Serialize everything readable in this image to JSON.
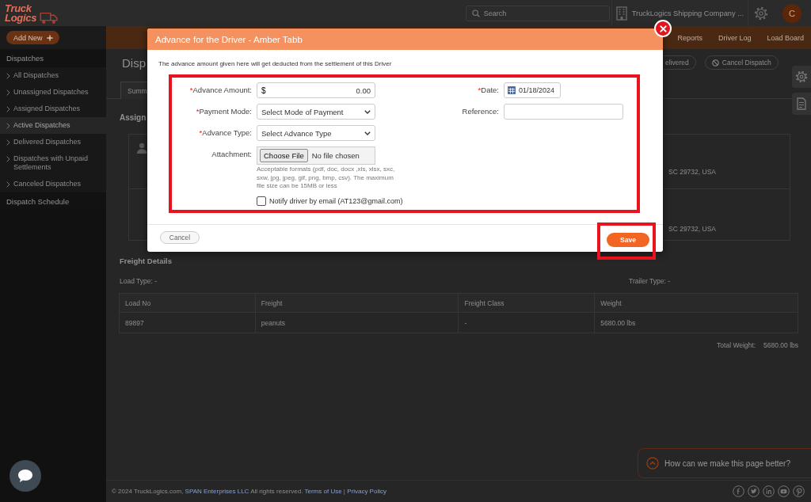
{
  "header": {
    "logo": {
      "line_1": "Truck",
      "line_2": "Logics"
    },
    "search": {
      "placeholder": "Search"
    },
    "company": "TruckLogics Shipping Company ...",
    "avatar_initial": "C"
  },
  "nav": {
    "add_button": "Add New",
    "links": [
      "Reports",
      "Driver Log",
      "Load Board"
    ]
  },
  "sidebar": {
    "sections": [
      {
        "title": "Dispatches",
        "items": [
          {
            "label": "All Dispatches",
            "selected": false
          },
          {
            "label": "Unassigned Dispatches",
            "selected": false
          },
          {
            "label": "Assigned Dispatches",
            "selected": false
          },
          {
            "label": "Active Dispatches",
            "selected": true
          },
          {
            "label": "Delivered Dispatches",
            "selected": false
          },
          {
            "label": "Dispatches with Unpaid Settlements",
            "selected": false
          },
          {
            "label": "Canceled Dispatches",
            "selected": false
          }
        ]
      },
      {
        "title": "Dispatch Schedule"
      }
    ]
  },
  "page": {
    "title": "Disp",
    "actions": [
      {
        "label": "elivered",
        "kind": "plain"
      },
      {
        "label": "Cancel Dispatch",
        "kind": "cancel"
      }
    ],
    "tabs": [
      {
        "label": "Summ",
        "selected": true
      }
    ],
    "assign": {
      "title": "Assign",
      "cards": [
        {
          "kind": "driver",
          "address": "SC 29732, USA"
        },
        {
          "kind": "location",
          "address": "SC 29732, USA"
        }
      ]
    },
    "freight": {
      "title": "Freight Details",
      "load_type": "Load Type: -",
      "trailer_type": "Trailer Type: -",
      "table": {
        "columns": [
          "Load No",
          "Freight",
          "Freight Class",
          "Weight"
        ],
        "rows": [
          [
            "89897",
            "peanuts",
            "-",
            "5680.00 lbs"
          ]
        ]
      },
      "total_label": "Total Weight:",
      "total_value": "5680.00 lbs"
    }
  },
  "footer": {
    "copyright": "© 2024 TruckLogics.com,",
    "company_link": "SPAN Enterprises LLC",
    "rights": "All rights reserved.",
    "links": [
      "Terms of Use",
      "Privacy Policy"
    ],
    "separator": "|"
  },
  "feedback": {
    "label": "How can we make this page better?"
  },
  "modal": {
    "title": "Advance for the Driver - Amber Tabb",
    "intro": "The advance amount given here will get deducted from the settlement of this Driver",
    "required_mark": "*",
    "form_highlighted": true,
    "left_fields": [
      {
        "kind": "amount",
        "label": "Advance Amount:",
        "required": true,
        "prefix": "$",
        "value": "0.00"
      },
      {
        "kind": "select",
        "label": "Payment Mode:",
        "required": true,
        "value": "Select Mode of Payment"
      },
      {
        "kind": "select",
        "label": "Advance Type:",
        "required": true,
        "value": "Select Advance Type"
      },
      {
        "kind": "file",
        "label": "Attachment:",
        "required": false,
        "button": "Choose File",
        "value": "No file chosen",
        "hint": "Acceptable formats (pdf, doc, docx ,xls, xlsx, sxc, sxw, jpg, jpeg, gif, png, bmp, csv). The maximum file size can be 15MB or less"
      }
    ],
    "right_fields": [
      {
        "kind": "date",
        "label": "Date:",
        "required": true,
        "value": "01/18/2024"
      },
      {
        "kind": "text",
        "label": "Reference:",
        "required": false
      }
    ],
    "notify": {
      "label": "Notify driver by email (AT123@gmail.com)",
      "checked": false
    },
    "buttons": [
      {
        "label": "Cancel",
        "kind": "secondary",
        "highlighted": false
      },
      {
        "label": "Save",
        "kind": "primary",
        "highlighted": true
      }
    ]
  }
}
